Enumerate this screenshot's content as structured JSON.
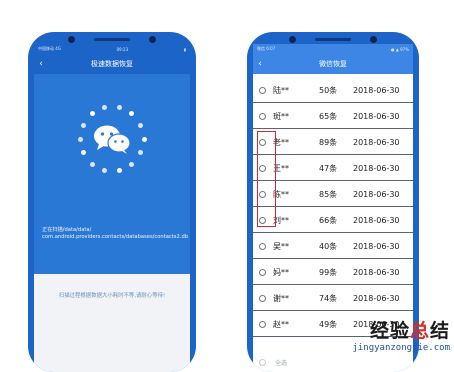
{
  "left_phone": {
    "status": {
      "left": "中国移动 4G",
      "time": "09:23"
    },
    "title": "极速数据恢复",
    "scan_prefix": "正在扫描/data/data/",
    "scan_path": "com.android.providers.contacts/databases/contacts2.db",
    "tip": "扫描过程根据数据大小耗时不等,请耐心等待!"
  },
  "right_phone": {
    "status": {
      "left": "微信 6:07",
      "right": "● ▲ 97%"
    },
    "title": "微信恢复",
    "rows": [
      {
        "name": "陆**",
        "count": "50条",
        "date": "2018-06-30"
      },
      {
        "name": "斑**",
        "count": "65条",
        "date": "2018-06-30"
      },
      {
        "name": "老**",
        "count": "89条",
        "date": "2018-06-30"
      },
      {
        "name": "王**",
        "count": "47条",
        "date": "2018-06-30"
      },
      {
        "name": "陈**",
        "count": "85条",
        "date": "2018-06-30"
      },
      {
        "name": "刘**",
        "count": "66条",
        "date": "2018-06-30"
      },
      {
        "name": "吴**",
        "count": "40条",
        "date": "2018-06-30"
      },
      {
        "name": "妈**",
        "count": "99条",
        "date": "2018-06-30"
      },
      {
        "name": "谢**",
        "count": "74条",
        "date": "2018-06-30"
      },
      {
        "name": "赵**",
        "count": "49条",
        "date": "2018-06-30"
      }
    ],
    "select_all": "全选"
  },
  "watermark": {
    "title_a": "经验",
    "title_b": "总",
    "title_c": "结",
    "url": "jingyanzongjie.com"
  },
  "colors": {
    "phone_blue": "#1d64c8",
    "highlight_red": "#d8262c"
  }
}
